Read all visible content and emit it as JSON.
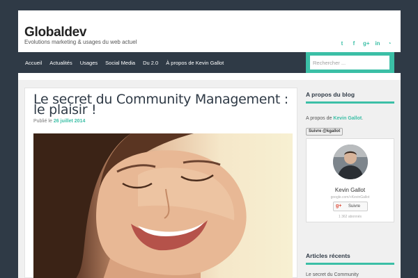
{
  "site": {
    "title": "Globaldev",
    "tagline": "Evolutions marketing & usages du web actuel"
  },
  "social_icons": [
    {
      "icon": "twitter-icon",
      "glyph": "t"
    },
    {
      "icon": "facebook-icon",
      "glyph": "f"
    },
    {
      "icon": "google-plus-icon",
      "glyph": "g+"
    },
    {
      "icon": "linkedin-icon",
      "glyph": "in"
    },
    {
      "icon": "rss-icon",
      "glyph": "◔"
    }
  ],
  "nav": {
    "items": [
      "Accueil",
      "Actualités",
      "Usages",
      "Social Media",
      "Du 2.0",
      "À propos de Kevin Gallot"
    ],
    "search_placeholder": "Rechercher ..."
  },
  "post": {
    "title": "Le secret du Community Management : le plaisir !",
    "meta_prefix": "Publié le",
    "date": "26 juillet 2014"
  },
  "sidebar": {
    "about_title": "A propos du blog",
    "about_prefix": "A propos de",
    "about_name": "Kevin Gallot",
    "about_suffix": ".",
    "twitter_follow": "Suivre @kgallot",
    "gplus_card": {
      "name": "Kevin Gallot",
      "url": "google.com/+KevinGallot",
      "button": "Suivre",
      "followers": "1 362 abonnés"
    },
    "recent_title": "Articles récents",
    "recent_items": [
      "Le secret du Community"
    ]
  },
  "colors": {
    "accent": "#3bbfa6",
    "nav_bg": "#2f3a46",
    "page_bg": "#2f3a46"
  }
}
